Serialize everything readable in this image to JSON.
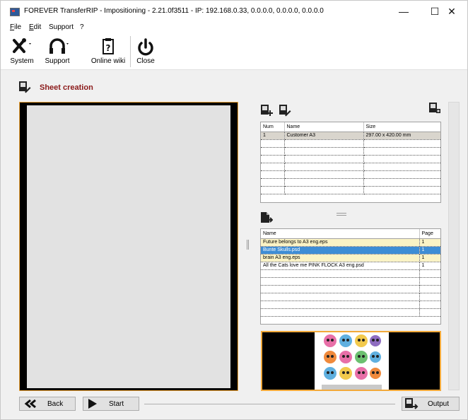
{
  "window": {
    "title": "FOREVER TransferRIP - Impositioning - 2.21.0f3511 - IP: 192.168.0.33, 0.0.0.0, 0.0.0.0, 0.0.0.0",
    "minimize": "—",
    "maximize": "☐",
    "close": "✕"
  },
  "menu": {
    "file_u": "F",
    "file_rest": "ile",
    "edit_u": "E",
    "edit_rest": "dit",
    "support": "Support",
    "help": "?"
  },
  "toolbar": {
    "system": "System",
    "support": "Support",
    "online_wiki": "Online wiki",
    "close": "Close"
  },
  "header": {
    "title": "Sheet creation"
  },
  "sheets": {
    "columns": [
      "Num",
      "Name",
      "Size"
    ],
    "rows": [
      [
        "1",
        "Customer A3",
        "297.00 x 420.00 mm"
      ],
      [
        "",
        "",
        ""
      ],
      [
        "",
        "",
        ""
      ],
      [
        "",
        "",
        ""
      ],
      [
        "",
        "",
        ""
      ],
      [
        "",
        "",
        ""
      ],
      [
        "",
        "",
        ""
      ],
      [
        "",
        "",
        ""
      ],
      [
        "",
        "",
        ""
      ]
    ]
  },
  "files": {
    "columns": [
      "Name",
      "Page"
    ],
    "rows": [
      [
        "Future belongs to A3 eng.eps",
        "1"
      ],
      [
        "Bunte Skulls.psd",
        "1"
      ],
      [
        "brain A3 eng.eps",
        "1"
      ],
      [
        "All the Cats love me PINK FLOCK A3 eng.psd",
        "1"
      ],
      [
        "",
        ""
      ],
      [
        "",
        ""
      ],
      [
        "",
        ""
      ],
      [
        "",
        ""
      ],
      [
        "",
        ""
      ],
      [
        "",
        ""
      ]
    ]
  },
  "footer": {
    "back": "Back",
    "start": "Start",
    "output": "Output"
  },
  "colors": {
    "accent_orange": "#f2a93b",
    "title_red": "#8b1a1a",
    "selection_blue": "#3e8dd5",
    "row_yellow": "#fbf3c5"
  },
  "icons": {
    "system": "tools-icon",
    "support": "headset-icon",
    "wiki": "clipboard-help-icon",
    "close": "power-icon",
    "add_sheet": "add-sheet-icon",
    "edit_sheet": "edit-sheet-icon",
    "sheet_settings": "sheet-settings-icon",
    "file_import": "file-import-icon",
    "back": "double-chevron-left-icon",
    "start": "play-icon",
    "output": "output-icon"
  }
}
